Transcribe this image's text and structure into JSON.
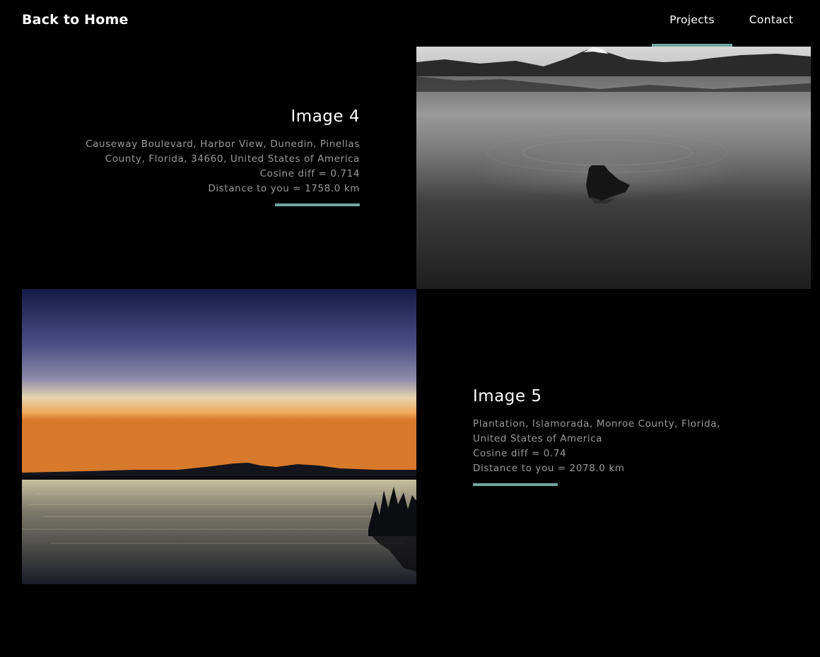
{
  "header": {
    "brand_label": "Back to Home",
    "nav": [
      {
        "label": "Projects",
        "active": true
      },
      {
        "label": "Contact",
        "active": false
      }
    ],
    "accent_color": "#6ea69e"
  },
  "items": [
    {
      "title": "Image 4",
      "address_line_1": "Causeway Boulevard, Harbor View, Dunedin, Pinellas",
      "address_line_2": "County, Florida, 34660, United States of America",
      "cosine": "Cosine diff = 0.714",
      "distance": "Distance to you = 1758.0 km",
      "photo": "black-and-white-lake-with-mountain-photo"
    },
    {
      "title": "Image 5",
      "address_line_1": "Plantation, Islamorada, Monroe County, Florida,",
      "address_line_2": "United States of America",
      "cosine": "Cosine diff = 0.74",
      "distance": "Distance to you = 2078.0 km",
      "photo": "sunset-over-lake-photo"
    }
  ]
}
